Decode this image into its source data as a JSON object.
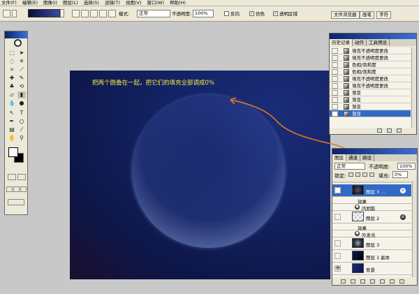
{
  "menu": [
    "文件(F)",
    "编辑(E)",
    "图像(I)",
    "图层(L)",
    "选择(S)",
    "滤镜(T)",
    "视图(V)",
    "窗口(W)",
    "帮助(H)"
  ],
  "options": {
    "mode_label": "模式:",
    "mode_value": "正常",
    "opacity_label": "不透明度:",
    "opacity_value": "100%",
    "reverse_label": "反向",
    "dither_label": "仿色",
    "transparency_label": "透明区域",
    "reverse_checked": false,
    "dither_checked": true,
    "transparency_checked": true
  },
  "palette_well": {
    "tabs": [
      "文件浏览器",
      "画笔",
      "字符"
    ]
  },
  "canvas": {
    "instruction": "把两个圆叠在一起，把它们的填充全部调成0%"
  },
  "history_panel": {
    "tabs": [
      "历史记录",
      "动作",
      "工具预设"
    ],
    "items": [
      {
        "label": "填充不透明度更改",
        "selected": false
      },
      {
        "label": "填充不透明度更改",
        "selected": false
      },
      {
        "label": "色相/饱和度",
        "selected": false
      },
      {
        "label": "色相/饱和度",
        "selected": false
      },
      {
        "label": "填充不透明度更改",
        "selected": false
      },
      {
        "label": "填充不透明度更改",
        "selected": false
      },
      {
        "label": "渐变",
        "selected": false
      },
      {
        "label": "渐变",
        "selected": false
      },
      {
        "label": "渐变",
        "selected": false
      },
      {
        "label": "渐变",
        "selected": true
      }
    ]
  },
  "layers_panel": {
    "tabs": [
      "图层",
      "通道",
      "路径"
    ],
    "blend_mode": "正常",
    "opacity_label": "不透明度:",
    "opacity_value": "100%",
    "lock_label": "锁定:",
    "fill_label": "填充:",
    "fill_value": "0%",
    "layers": [
      {
        "name": "图层 3 ...",
        "kind": "layer",
        "selected": true
      },
      {
        "name": "效果",
        "kind": "effects"
      },
      {
        "name": "内阴影",
        "kind": "effect"
      },
      {
        "name": "图层 2",
        "kind": "layer",
        "selected": false
      },
      {
        "name": "效果",
        "kind": "effects"
      },
      {
        "name": "外发光",
        "kind": "effect"
      },
      {
        "name": "图层 3",
        "kind": "layer",
        "selected": false
      },
      {
        "name": "图层 1 副本",
        "kind": "layer",
        "selected": false
      },
      {
        "name": "背景",
        "kind": "layer",
        "selected": false
      }
    ]
  },
  "colors": {
    "canvas_bg": "#132263",
    "instruction_text": "#f0ea45",
    "annotation": "#e07a1e",
    "selection": "#316ac5"
  }
}
